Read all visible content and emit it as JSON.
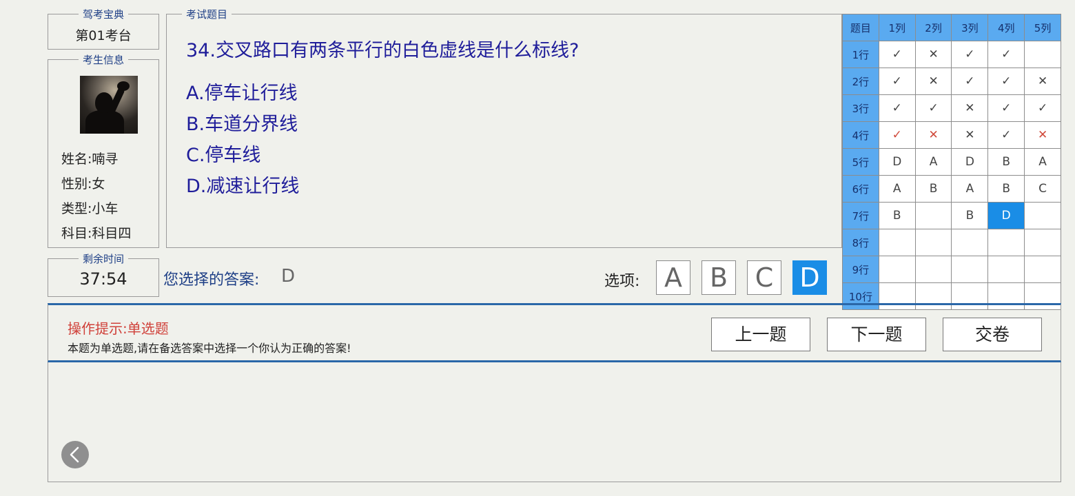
{
  "brand": {
    "legend": "驾考宝典",
    "value": "第01考台"
  },
  "examinee": {
    "legend": "考生信息",
    "name": "姓名:喃寻",
    "gender": "性别:女",
    "type": "类型:小车",
    "subject": "科目:科目四"
  },
  "timer": {
    "legend": "剩余时间",
    "value": "37:54"
  },
  "question": {
    "legend": "考试题目",
    "text": "34.交叉路口有两条平行的白色虚线是什么标线?",
    "options": [
      "A.停车让行线",
      "B.车道分界线",
      "C.停车线",
      "D.减速让行线"
    ]
  },
  "answer": {
    "label": "您选择的答案:",
    "value": "D"
  },
  "choices": {
    "label": "选项:",
    "buttons": [
      "A",
      "B",
      "C",
      "D"
    ],
    "selected": "D"
  },
  "grid": {
    "corner": "题目",
    "columns": [
      "1列",
      "2列",
      "3列",
      "4列",
      "5列"
    ],
    "rows": [
      {
        "label": "1行",
        "cells": [
          "✓",
          "✕",
          "✓",
          "✓",
          ""
        ],
        "wrong": [
          false,
          false,
          false,
          false,
          false
        ]
      },
      {
        "label": "2行",
        "cells": [
          "✓",
          "✕",
          "✓",
          "✓",
          "✕"
        ],
        "wrong": [
          false,
          false,
          false,
          false,
          false
        ]
      },
      {
        "label": "3行",
        "cells": [
          "✓",
          "✓",
          "✕",
          "✓",
          "✓"
        ],
        "wrong": [
          false,
          false,
          false,
          false,
          false
        ]
      },
      {
        "label": "4行",
        "cells": [
          "✓",
          "✕",
          "✕",
          "✓",
          "✕"
        ],
        "wrong": [
          true,
          true,
          false,
          false,
          true
        ]
      },
      {
        "label": "5行",
        "cells": [
          "D",
          "A",
          "D",
          "B",
          "A"
        ],
        "wrong": [
          false,
          false,
          false,
          false,
          false
        ]
      },
      {
        "label": "6行",
        "cells": [
          "A",
          "B",
          "A",
          "B",
          "C"
        ],
        "wrong": [
          false,
          false,
          false,
          false,
          false
        ]
      },
      {
        "label": "7行",
        "cells": [
          "B",
          "",
          "B",
          "D",
          ""
        ],
        "wrong": [
          false,
          false,
          false,
          false,
          false
        ]
      },
      {
        "label": "8行",
        "cells": [
          "",
          "",
          "",
          "",
          ""
        ],
        "wrong": [
          false,
          false,
          false,
          false,
          false
        ]
      },
      {
        "label": "9行",
        "cells": [
          "",
          "",
          "",
          "",
          ""
        ],
        "wrong": [
          false,
          false,
          false,
          false,
          false
        ]
      },
      {
        "label": "10行",
        "cells": [
          "",
          "",
          "",
          "",
          ""
        ],
        "wrong": [
          false,
          false,
          false,
          false,
          false
        ]
      }
    ],
    "current": {
      "row": 7,
      "col": 4
    },
    "colors": {
      "header": "#5aaaf0",
      "current": "#1a8de6",
      "wrong_mark": "#d04a3b"
    }
  },
  "tips": {
    "title": "操作提示:单选题",
    "text": "本题为单选题,请在备选答案中选择一个你认为正确的答案!"
  },
  "nav": {
    "prev": "上一题",
    "next": "下一题",
    "submit": "交卷"
  },
  "back": {
    "icon": "chevron-left-icon"
  }
}
